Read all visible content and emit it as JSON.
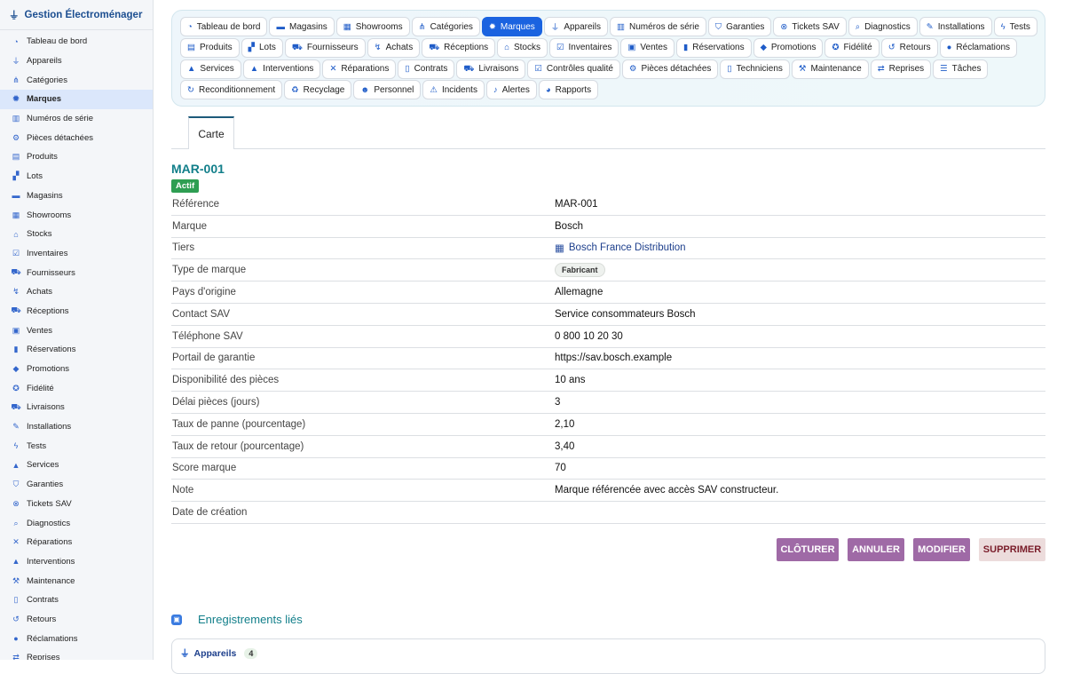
{
  "sidebar": {
    "brand_icon": "plug-icon",
    "brand": "Gestion Électroménager",
    "items": [
      {
        "label": "Tableau de bord",
        "icon": "dashboard-icon"
      },
      {
        "label": "Appareils",
        "icon": "plug-icon"
      },
      {
        "label": "Catégories",
        "icon": "sitemap-icon"
      },
      {
        "label": "Marques",
        "icon": "badge-icon",
        "active": true
      },
      {
        "label": "Numéros de série",
        "icon": "barcode-icon"
      },
      {
        "label": "Pièces détachées",
        "icon": "gear-icon"
      },
      {
        "label": "Produits",
        "icon": "box-icon"
      },
      {
        "label": "Lots",
        "icon": "boxes-icon"
      },
      {
        "label": "Magasins",
        "icon": "store-icon"
      },
      {
        "label": "Showrooms",
        "icon": "grid-icon"
      },
      {
        "label": "Stocks",
        "icon": "warehouse-icon"
      },
      {
        "label": "Inventaires",
        "icon": "clipboard-check-icon"
      },
      {
        "label": "Fournisseurs",
        "icon": "truck-icon"
      },
      {
        "label": "Achats",
        "icon": "dolly-icon"
      },
      {
        "label": "Réceptions",
        "icon": "truck-loading-icon"
      },
      {
        "label": "Ventes",
        "icon": "cash-register-icon"
      },
      {
        "label": "Réservations",
        "icon": "bookmark-icon"
      },
      {
        "label": "Promotions",
        "icon": "tags-icon"
      },
      {
        "label": "Fidélité",
        "icon": "award-icon"
      },
      {
        "label": "Livraisons",
        "icon": "shipping-fast-icon"
      },
      {
        "label": "Installations",
        "icon": "wrench-icon"
      },
      {
        "label": "Tests",
        "icon": "bolt-icon"
      },
      {
        "label": "Services",
        "icon": "bell-concierge-icon"
      },
      {
        "label": "Garanties",
        "icon": "shield-icon"
      },
      {
        "label": "Tickets SAV",
        "icon": "life-ring-icon"
      },
      {
        "label": "Diagnostics",
        "icon": "search-icon"
      },
      {
        "label": "Réparations",
        "icon": "tools-icon"
      },
      {
        "label": "Interventions",
        "icon": "hard-hat-icon"
      },
      {
        "label": "Maintenance",
        "icon": "hammer-icon"
      },
      {
        "label": "Contrats",
        "icon": "file-contract-icon"
      },
      {
        "label": "Retours",
        "icon": "undo-icon"
      },
      {
        "label": "Réclamations",
        "icon": "comment-dots-icon"
      },
      {
        "label": "Reprises",
        "icon": "exchange-icon"
      }
    ]
  },
  "tabs": {
    "rows": [
      [
        {
          "label": "Tableau de bord",
          "icon": "dashboard-icon"
        },
        {
          "label": "Magasins",
          "icon": "store-icon"
        },
        {
          "label": "Showrooms",
          "icon": "grid-icon"
        },
        {
          "label": "Catégories",
          "icon": "sitemap-icon"
        },
        {
          "label": "Marques",
          "icon": "badge-icon",
          "active": true
        },
        {
          "label": "Appareils",
          "icon": "plug-icon"
        },
        {
          "label": "Numéros de série",
          "icon": "barcode-icon"
        },
        {
          "label": "Garanties",
          "icon": "shield-icon"
        },
        {
          "label": "Tickets SAV",
          "icon": "life-ring-icon"
        },
        {
          "label": "Diagnostics",
          "icon": "search-icon"
        },
        {
          "label": "Installations",
          "icon": "wrench-icon"
        },
        {
          "label": "Tests",
          "icon": "bolt-icon"
        }
      ],
      [
        {
          "label": "Produits",
          "icon": "box-icon"
        },
        {
          "label": "Lots",
          "icon": "boxes-icon"
        },
        {
          "label": "Fournisseurs",
          "icon": "truck-icon"
        },
        {
          "label": "Achats",
          "icon": "dolly-icon"
        },
        {
          "label": "Réceptions",
          "icon": "truck-loading-icon"
        },
        {
          "label": "Stocks",
          "icon": "warehouse-icon"
        },
        {
          "label": "Inventaires",
          "icon": "clipboard-check-icon"
        },
        {
          "label": "Ventes",
          "icon": "cash-register-icon"
        },
        {
          "label": "Réservations",
          "icon": "bookmark-icon"
        },
        {
          "label": "Promotions",
          "icon": "tags-icon"
        },
        {
          "label": "Fidélité",
          "icon": "award-icon"
        },
        {
          "label": "Retours",
          "icon": "undo-icon"
        },
        {
          "label": "Réclamations",
          "icon": "comment-dots-icon"
        }
      ],
      [
        {
          "label": "Services",
          "icon": "bell-concierge-icon"
        },
        {
          "label": "Interventions",
          "icon": "hard-hat-icon"
        },
        {
          "label": "Réparations",
          "icon": "tools-icon"
        },
        {
          "label": "Contrats",
          "icon": "file-contract-icon"
        },
        {
          "label": "Livraisons",
          "icon": "shipping-fast-icon"
        },
        {
          "label": "Contrôles qualité",
          "icon": "clipboard-check-icon"
        },
        {
          "label": "Pièces détachées",
          "icon": "gear-icon"
        },
        {
          "label": "Techniciens",
          "icon": "id-badge-icon"
        },
        {
          "label": "Maintenance",
          "icon": "hammer-icon"
        },
        {
          "label": "Reprises",
          "icon": "exchange-icon"
        },
        {
          "label": "Tâches",
          "icon": "list-icon"
        }
      ],
      [
        {
          "label": "Reconditionnement",
          "icon": "redo-icon"
        },
        {
          "label": "Recyclage",
          "icon": "recycle-icon"
        },
        {
          "label": "Personnel",
          "icon": "users-icon"
        },
        {
          "label": "Incidents",
          "icon": "warning-icon"
        },
        {
          "label": "Alertes",
          "icon": "bell-icon"
        },
        {
          "label": "Rapports",
          "icon": "chart-pie-icon"
        }
      ]
    ]
  },
  "view_tab": "Carte",
  "record": {
    "title": "MAR-001",
    "status": "Actif",
    "status_color": "#2e9e52",
    "fields": [
      {
        "label": "Référence",
        "value": "MAR-001"
      },
      {
        "label": "Marque",
        "value": "Bosch"
      },
      {
        "label": "Tiers",
        "value": "Bosch France Distribution",
        "kind": "link",
        "icon": "building-icon"
      },
      {
        "label": "Type de marque",
        "value": "Fabricant",
        "kind": "pill"
      },
      {
        "label": "Pays d'origine",
        "value": "Allemagne"
      },
      {
        "label": "Contact SAV",
        "value": "Service consommateurs Bosch"
      },
      {
        "label": "Téléphone SAV",
        "value": "0 800 10 20 30"
      },
      {
        "label": "Portail de garantie",
        "value": "https://sav.bosch.example"
      },
      {
        "label": "Disponibilité des pièces",
        "value": "10 ans"
      },
      {
        "label": "Délai pièces (jours)",
        "value": "3"
      },
      {
        "label": "Taux de panne (pourcentage)",
        "value": "2,10"
      },
      {
        "label": "Taux de retour (pourcentage)",
        "value": "3,40"
      },
      {
        "label": "Score marque",
        "value": "70"
      },
      {
        "label": "Note",
        "value": "Marque référencée avec accès SAV constructeur."
      },
      {
        "label": "Date de création",
        "value": ""
      }
    ]
  },
  "actions": {
    "close": "CLÔTURER",
    "cancel": "ANNULER",
    "edit": "MODIFIER",
    "delete": "SUPPRIMER"
  },
  "related": {
    "icon": "cube-icon",
    "title": "Enregistrements liés",
    "first_card": {
      "label": "Appareils",
      "icon": "plug-icon",
      "count": "4"
    }
  },
  "colors": {
    "accent": "#1a63e0",
    "title_teal": "#127f8a",
    "button_purple": "#9f6aa6"
  }
}
